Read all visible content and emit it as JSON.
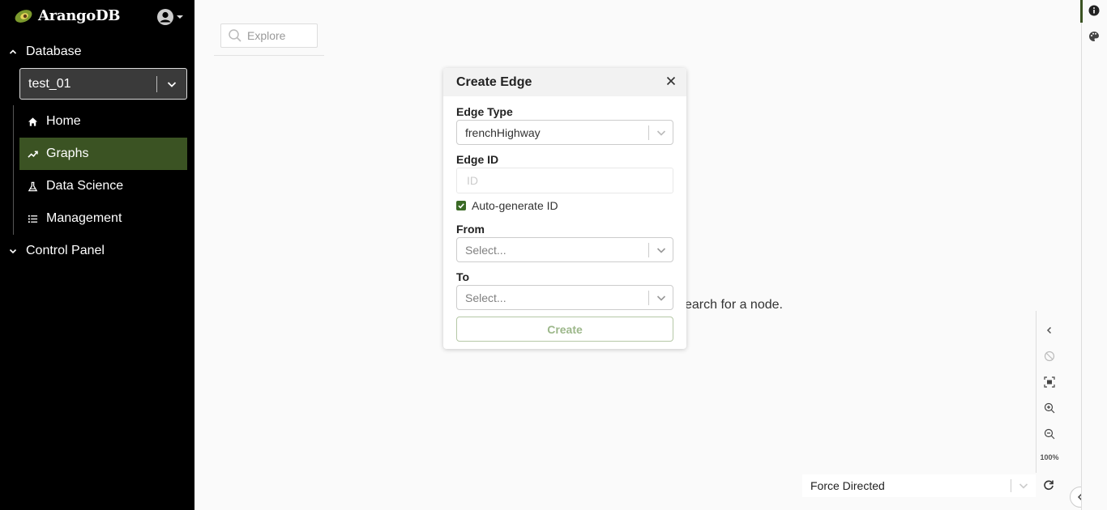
{
  "app": {
    "name": "ArangoDB"
  },
  "sidebar": {
    "database_header": "Database",
    "db_select_value": "test_01",
    "nav": [
      {
        "label": "Home",
        "icon": "home-icon"
      },
      {
        "label": "Graphs",
        "icon": "graph-icon",
        "active": true
      },
      {
        "label": "Data Science",
        "icon": "flask-icon"
      },
      {
        "label": "Management",
        "icon": "list-icon"
      }
    ],
    "control_panel_header": "Control Panel"
  },
  "main": {
    "search_placeholder": "Explore",
    "background_hint": "earch for a node."
  },
  "dialog": {
    "title": "Create Edge",
    "edge_type_label": "Edge Type",
    "edge_type_value": "frenchHighway",
    "edge_id_label": "Edge ID",
    "edge_id_placeholder": "ID",
    "autogen_label": "Auto-generate ID",
    "autogen_checked": true,
    "from_label": "From",
    "from_placeholder": "Select...",
    "to_label": "To",
    "to_placeholder": "Select...",
    "create_label": "Create"
  },
  "graph_controls": {
    "zoom_level": "100%",
    "layout_value": "Force Directed"
  },
  "colors": {
    "accent": "#3b5323",
    "sidebar_bg": "#000000"
  }
}
